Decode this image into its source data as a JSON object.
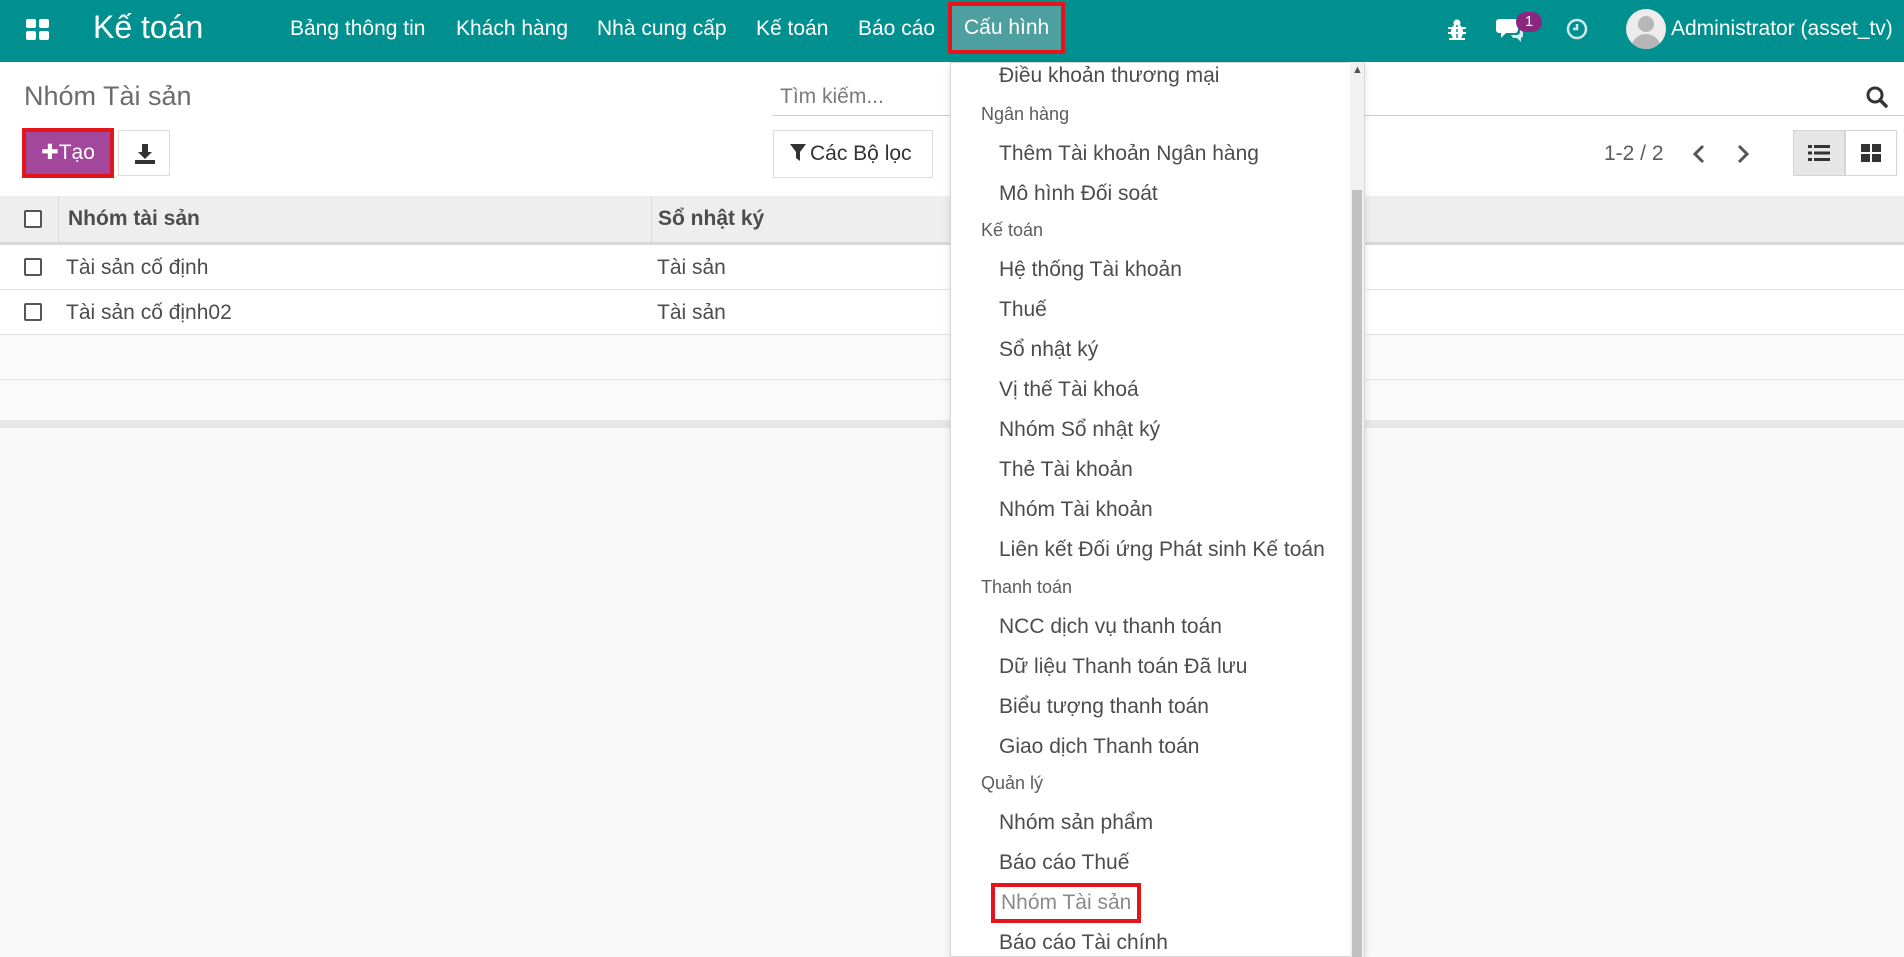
{
  "navbar": {
    "brand": "Kế toán",
    "menu": [
      "Bảng thông tin",
      "Khách hàng",
      "Nhà cung cấp",
      "Kế toán",
      "Báo cáo",
      "Cấu hình"
    ],
    "messages_badge": "1",
    "user": "Administrator (asset_tv)",
    "icons": [
      "apps-grid-icon",
      "bug-icon",
      "chat-icon",
      "clock-icon",
      "avatar-icon"
    ],
    "colors": {
      "navbar_bg": "#00908f",
      "active_bg": "#4d9fa0",
      "highlight": "#e3151b",
      "create_btn": "#a3479c"
    }
  },
  "control": {
    "title": "Nhóm Tài sản",
    "create_label": "Tạo",
    "search_placeholder": "Tìm kiếm...",
    "filter_label": "Các Bộ lọc",
    "pager": "1-2 / 2"
  },
  "table": {
    "columns": [
      "Nhóm tài sản",
      "Sổ nhật ký"
    ],
    "rows": [
      [
        "Tài sản cố định",
        "Tài sản"
      ],
      [
        "Tài sản cố định02",
        "Tài sản"
      ]
    ]
  },
  "dropdown": {
    "truncated_top_item": "Điều khoản thương mại",
    "sections": [
      {
        "header": "Ngân hàng",
        "items": [
          "Thêm Tài khoản Ngân hàng",
          "Mô hình Đối soát"
        ]
      },
      {
        "header": "Kế toán",
        "items": [
          "Hệ thống Tài khoản",
          "Thuế",
          "Sổ nhật ký",
          "Vị thế Tài khoá",
          "Nhóm Sổ nhật ký",
          "Thẻ Tài khoản",
          "Nhóm Tài khoản",
          "Liên kết Đối ứng Phát sinh Kế toán"
        ]
      },
      {
        "header": "Thanh toán",
        "items": [
          "NCC dịch vụ thanh toán",
          "Dữ liệu Thanh toán Đã lưu",
          "Biểu tượng thanh toán",
          "Giao dịch Thanh toán"
        ]
      },
      {
        "header": "Quản lý",
        "items": [
          "Nhóm sản phẩm",
          "Báo cáo Thuế",
          "Nhóm Tài sản",
          "Báo cáo Tài chính"
        ]
      }
    ]
  }
}
